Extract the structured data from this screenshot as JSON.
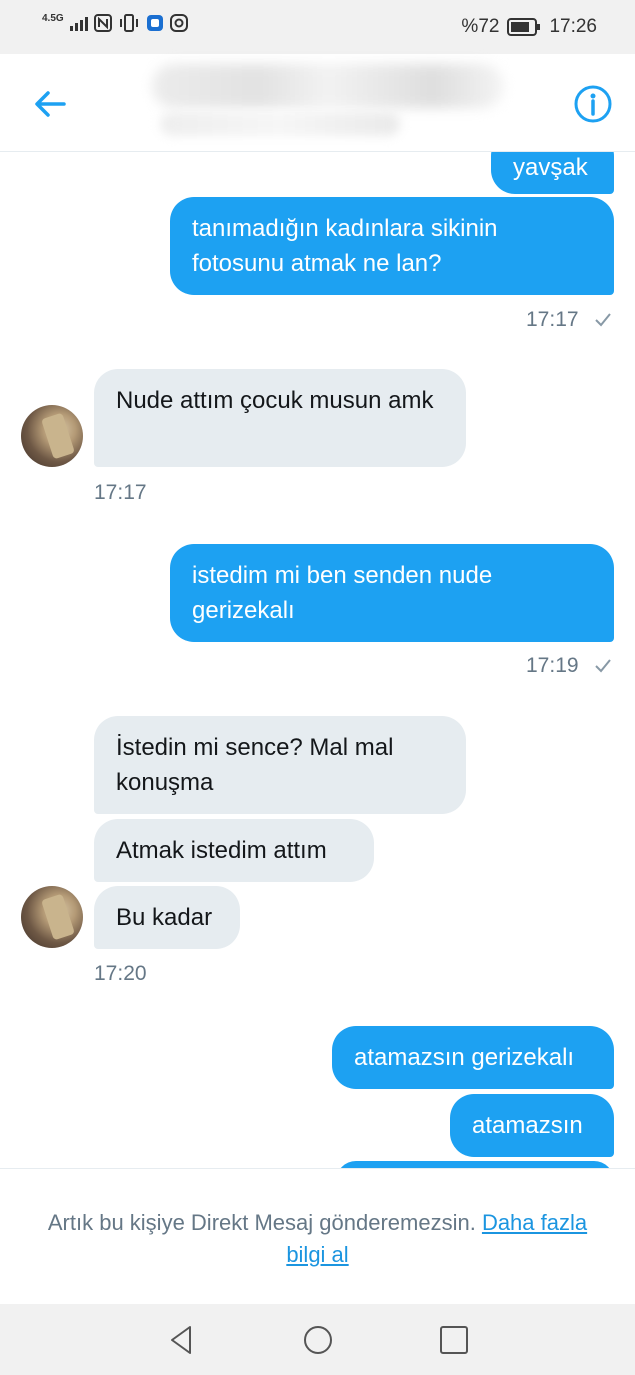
{
  "status_bar": {
    "network": "4.5G",
    "battery": "%72",
    "time": "17:26"
  },
  "header": {
    "name": "",
    "handle": ""
  },
  "messages": [
    {
      "text": "yavşak",
      "direction": "outgoing"
    },
    {
      "text": "tanımadığın kadınlara sikinin fotosunu atmak ne lan?",
      "direction": "outgoing"
    },
    {
      "text": "17:17",
      "kind": "timestamp",
      "read_icon": "check-icon"
    },
    {
      "text": "Nude attım çocuk musun amk",
      "direction": "incoming"
    },
    {
      "text": "17:17",
      "kind": "timestamp"
    },
    {
      "text": "istedim mi ben senden nude gerizekalı",
      "direction": "outgoing"
    },
    {
      "text": "17:19",
      "kind": "timestamp",
      "read_icon": "check-icon"
    },
    {
      "text": "İstedin mi sence? Mal mal konuşma",
      "direction": "incoming"
    },
    {
      "text": "Atmak istedim attım",
      "direction": "incoming"
    },
    {
      "text": "Bu kadar",
      "direction": "incoming"
    },
    {
      "text": "17:20",
      "kind": "timestamp"
    },
    {
      "text": "atamazsın gerizekalı",
      "direction": "outgoing"
    },
    {
      "text": "atamazsın",
      "direction": "outgoing"
    }
  ],
  "footer": {
    "notice": "Artık bu kişiye Direkt Mesaj gönderemezsin.",
    "link": "Daha fazla bilgi al"
  },
  "colors": {
    "accent": "#1da1f2",
    "incoming_bubble": "#e6ecf0",
    "timestamp": "#657786"
  }
}
